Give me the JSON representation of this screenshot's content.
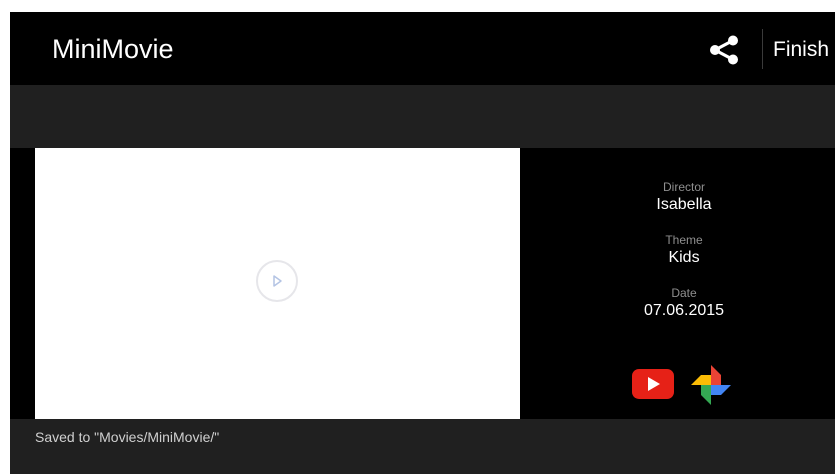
{
  "app": {
    "title": "MiniMovie"
  },
  "toolbar": {
    "share_icon": "share-icon",
    "finish_label": "Finish"
  },
  "video": {
    "play_icon": "play-icon"
  },
  "info": {
    "director_label": "Director",
    "director_value": "Isabella",
    "theme_label": "Theme",
    "theme_value": "Kids",
    "date_label": "Date",
    "date_value": "07.06.2015"
  },
  "share_targets": [
    {
      "icon": "youtube-icon",
      "color": "#e62117"
    },
    {
      "icon": "google-photos-icon",
      "colors": [
        "#ea4335",
        "#fbbc05",
        "#34a853",
        "#4285f4"
      ]
    }
  ],
  "status": {
    "message": "Saved to \"Movies/MiniMovie/\""
  },
  "colors": {
    "background": "#000000",
    "sub_bar": "#202020",
    "label": "#8f8f8f",
    "text": "#ffffff"
  }
}
